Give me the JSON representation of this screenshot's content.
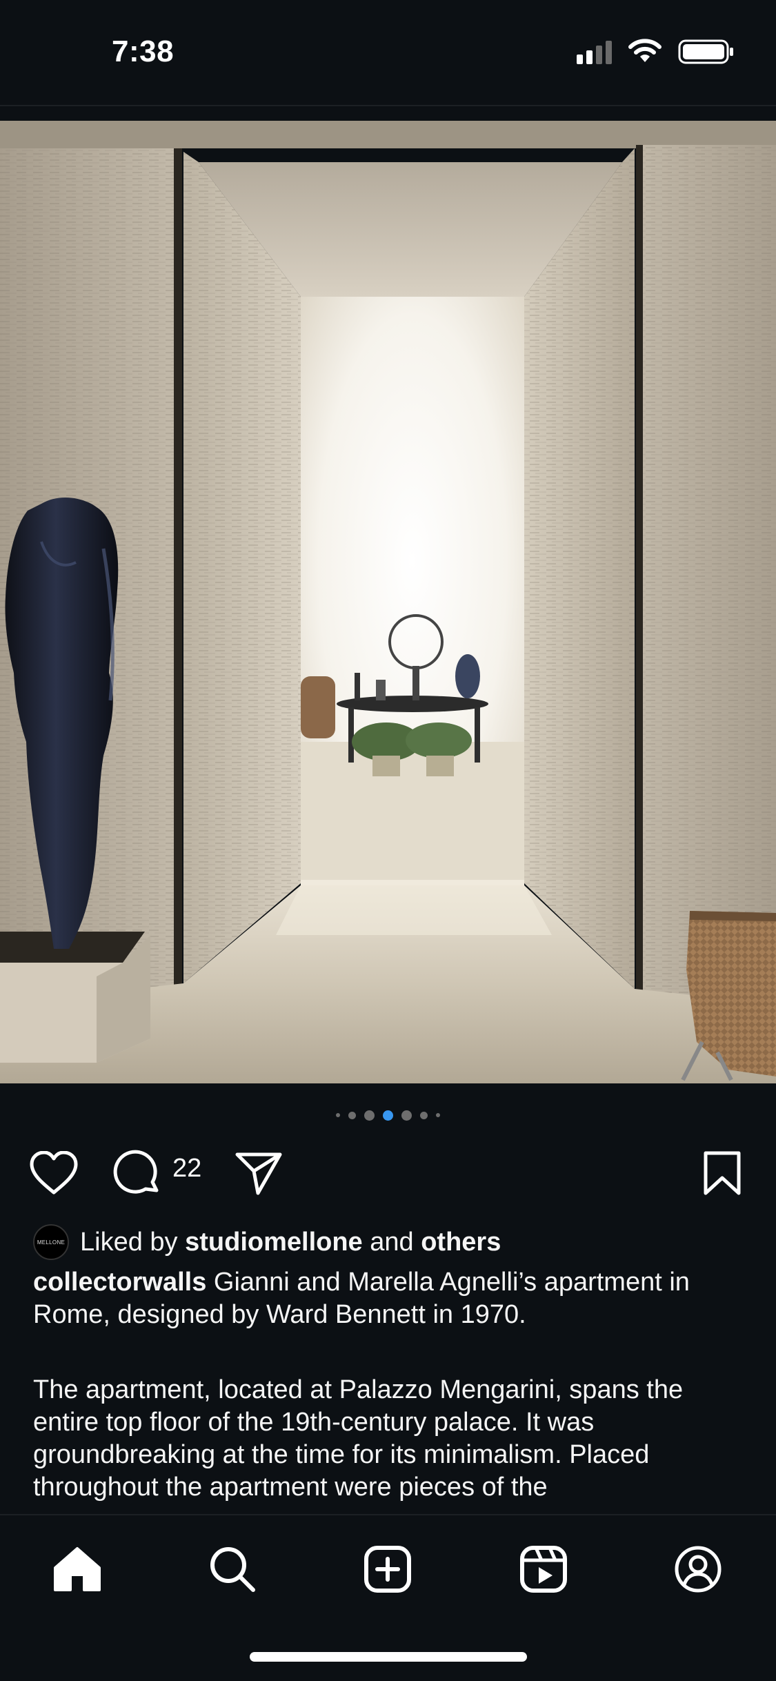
{
  "status_bar": {
    "time": "7:38"
  },
  "post": {
    "image_alt": "Travertine marble doorway with headless bronze statue and woven chair, leading to a bright room with a round table and plants",
    "carousel": {
      "total": 7,
      "active_index": 3
    },
    "actions": {
      "like_icon": "heart-icon",
      "comment_icon": "comment-icon",
      "comment_count": "22",
      "share_icon": "paper-plane-icon",
      "save_icon": "bookmark-icon"
    },
    "likes": {
      "avatar_text": "MELLONE",
      "prefix": "Liked by",
      "user": "studiomellone",
      "connector": "and",
      "others": "others"
    },
    "caption": {
      "username": "collectorwalls",
      "text": "Gianni and Marella Agnelli’s apartment in Rome, designed by Ward Bennett in 1970.",
      "paragraph2": "The apartment, located at Palazzo Mengarini, spans the entire top floor of the 19th-century palace. It was groundbreaking at the time for its minimalism. Placed throughout the apartment were pieces of the"
    }
  },
  "bottom_nav": {
    "items": [
      {
        "icon": "home-icon",
        "active": true
      },
      {
        "icon": "search-icon",
        "active": false
      },
      {
        "icon": "create-icon",
        "active": false
      },
      {
        "icon": "reels-icon",
        "active": false
      },
      {
        "icon": "profile-icon",
        "active": false
      }
    ]
  },
  "colors": {
    "background": "#0c1014",
    "text": "#f5f5f5",
    "carousel_active": "#3897f0",
    "carousel_inactive": "#6e6e6e"
  }
}
